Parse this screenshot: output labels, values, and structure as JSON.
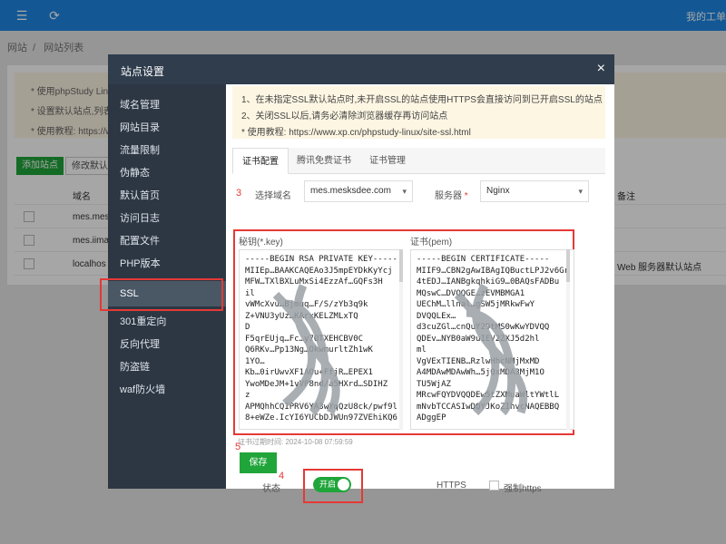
{
  "topbar": {
    "right_text": "我的工单"
  },
  "breadcrumb": [
    "网站",
    "网站列表"
  ],
  "background": {
    "notice_lines": [
      "* 使用phpStudy Linux",
      "* 设置默认站点,列表",
      "* 使用教程: https://www"
    ],
    "buttons": [
      "添加站点",
      "修改默认页"
    ],
    "table_header": "域名",
    "table_header_right": "备注",
    "rows": [
      "mes.mes",
      "mes.iima",
      "localhos"
    ],
    "row_note": "Web 服务器默认站点"
  },
  "modal": {
    "title": "站点设置",
    "close_icon": "×",
    "sidebar": [
      "域名管理",
      "网站目录",
      "流量限制",
      "伪静态",
      "默认首页",
      "访问日志",
      "配置文件",
      "PHP版本",
      "SSL",
      "301重定向",
      "反向代理",
      "防盗链",
      "waf防火墙"
    ],
    "active_item": "SSL",
    "tips": [
      "1、在未指定SSL默认站点时,未开启SSL的站点使用HTTPS会直接访问到已开启SSL的站点",
      "2、关闭SSL以后,请务必清除浏览器缓存再访问站点",
      "* 使用教程:  https://www.xp.cn/phpstudy-linux/site-ssl.html"
    ],
    "tabs": [
      "证书配置",
      "腾讯免费证书",
      "证书管理"
    ],
    "form": {
      "domain_label": "选择域名",
      "domain_value": "mes.mesksdee.com",
      "server_label": "服务器",
      "required_mark": "*",
      "server_value": "Nginx"
    },
    "key_label": "秘钥(*.key)",
    "cert_label": "证书(pem)",
    "key_text": "-----BEGIN RSA PRIVATE KEY-----\nMIIEp…BAAKCAQEAo3J5mpEYDkKyYcj\nMFW…TXlBXLuMxSi4EzzAf…GQFs3H\nil\nvWMcXvu…Bjmuq…F/S/zYb3q9k\nZ+VNU3yUz…KArxKELZMLxTQ\nD\nF5qrEUjq…Fc…y7QTXEHCBV0C\nQ6RKv…Pp13Ng…OkwmurltZh1wK\n1YO…\nKb…0irUwvXF1AOu+FfjR…EPEX1\nYwoMDeJM+1vVP8nd/a5HXrd…SDIHZ\nz\nAPMQhhCQIPRV6YA3wYqQzU8ck/pwf9l\n8+eWZe.IcYI6YUCbDJWUn97ZVEhiKQ6",
    "cert_text": "-----BEGIN CERTIFICATE-----\nMIIF9…CBN2gAwIBAgIQBuctLPJ2v6Gr\n4tEDJ…IANBgkqhkiG9…0BAQsFADBu\nMQswC…DVQQGE…zEVMBMGA1\nUEChM…llnal…gSW5jMRkwFwY\nDVQQLEx…\nd3cuZGl…cnQuY29tMS0wKwYDVQQ\nQDEv…NYB0aW9uIEV2ZXJ5d2hl\nml\nVgVExTIENB…RzlwHhcNMjMxMD\nA4MDAwMDAwWh…5jQxMDA3MjM1O\nTU5WjAZ\nMRcwFQYDVQQDEw5tZXMuaWltYWtlL\nmNvbTCCASIwDQYJKoZIhvcNAQEBBQ\nADggEP",
    "expire_text": "证书过期时间: 2024-10-08 07:59:59",
    "status_label": "状态",
    "toggle_label": "开启",
    "https_label": "HTTPS",
    "force_https_label": "强制https",
    "save_label": "保存",
    "step_numbers": [
      "3",
      "4",
      "5"
    ]
  }
}
